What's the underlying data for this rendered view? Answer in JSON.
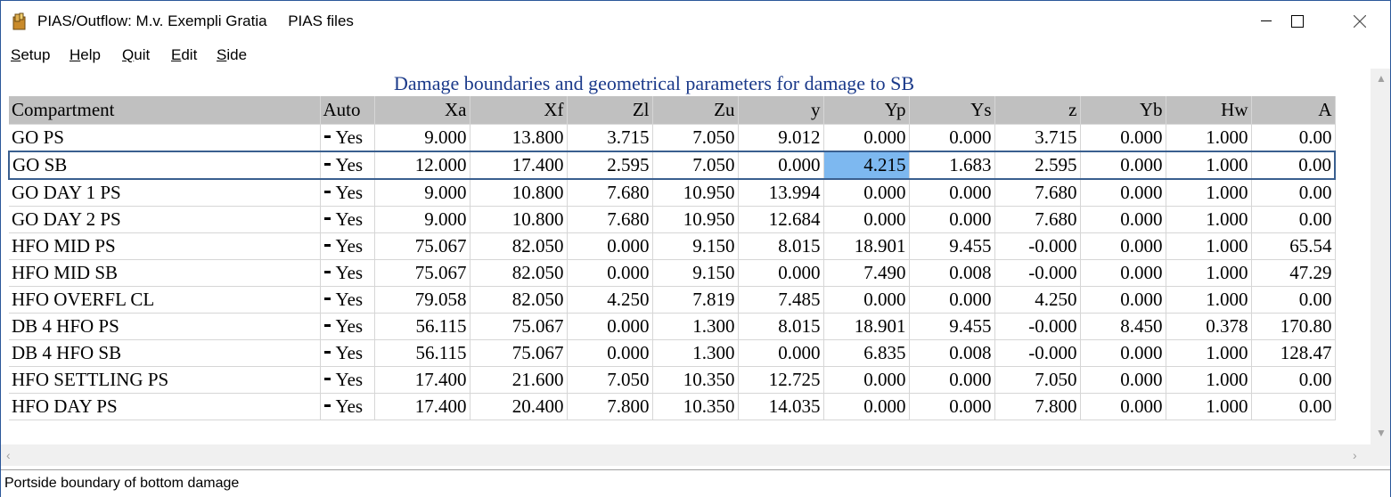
{
  "window": {
    "title": "PIAS/Outflow: M.v. Exempli Gratia     PIAS files",
    "minimize_label": "—",
    "maximize_label": "☐",
    "close_label": "✕"
  },
  "menu": [
    {
      "label": "Setup",
      "ul": "S",
      "rest": "etup"
    },
    {
      "label": "Help",
      "ul": "H",
      "rest": "elp"
    },
    {
      "label": "Quit",
      "ul": "Q",
      "rest": "uit"
    },
    {
      "label": "Edit",
      "ul": "E",
      "rest": "dit"
    },
    {
      "label": "Side",
      "ul": "S",
      "rest": "ide"
    }
  ],
  "heading": "Damage boundaries and geometrical parameters for damage to SB",
  "columns": [
    "Compartment",
    "Auto",
    "Xa",
    "Xf",
    "Zl",
    "Zu",
    "y",
    "Yp",
    "Ys",
    "z",
    "Yb",
    "Hw",
    "A"
  ],
  "rows": [
    [
      "GO PS",
      "Yes",
      "9.000",
      "13.800",
      "3.715",
      "7.050",
      "9.012",
      "0.000",
      "0.000",
      "3.715",
      "0.000",
      "1.000",
      "0.00"
    ],
    [
      "GO SB",
      "Yes",
      "12.000",
      "17.400",
      "2.595",
      "7.050",
      "0.000",
      "4.215",
      "1.683",
      "2.595",
      "0.000",
      "1.000",
      "0.00"
    ],
    [
      "GO DAY 1 PS",
      "Yes",
      "9.000",
      "10.800",
      "7.680",
      "10.950",
      "13.994",
      "0.000",
      "0.000",
      "7.680",
      "0.000",
      "1.000",
      "0.00"
    ],
    [
      "GO DAY 2 PS",
      "Yes",
      "9.000",
      "10.800",
      "7.680",
      "10.950",
      "12.684",
      "0.000",
      "0.000",
      "7.680",
      "0.000",
      "1.000",
      "0.00"
    ],
    [
      "HFO MID PS",
      "Yes",
      "75.067",
      "82.050",
      "0.000",
      "9.150",
      "8.015",
      "18.901",
      "9.455",
      "-0.000",
      "0.000",
      "1.000",
      "65.54"
    ],
    [
      "HFO MID SB",
      "Yes",
      "75.067",
      "82.050",
      "0.000",
      "9.150",
      "0.000",
      "7.490",
      "0.008",
      "-0.000",
      "0.000",
      "1.000",
      "47.29"
    ],
    [
      "HFO OVERFL CL",
      "Yes",
      "79.058",
      "82.050",
      "4.250",
      "7.819",
      "7.485",
      "0.000",
      "0.000",
      "4.250",
      "0.000",
      "1.000",
      "0.00"
    ],
    [
      "DB 4 HFO PS",
      "Yes",
      "56.115",
      "75.067",
      "0.000",
      "1.300",
      "8.015",
      "18.901",
      "9.455",
      "-0.000",
      "8.450",
      "0.378",
      "170.80"
    ],
    [
      "DB 4 HFO SB",
      "Yes",
      "56.115",
      "75.067",
      "0.000",
      "1.300",
      "0.000",
      "6.835",
      "0.008",
      "-0.000",
      "0.000",
      "1.000",
      "128.47"
    ],
    [
      "HFO SETTLING PS",
      "Yes",
      "17.400",
      "21.600",
      "7.050",
      "10.350",
      "12.725",
      "0.000",
      "0.000",
      "7.050",
      "0.000",
      "1.000",
      "0.00"
    ],
    [
      "HFO DAY PS",
      "Yes",
      "17.400",
      "20.400",
      "7.800",
      "10.350",
      "14.035",
      "0.000",
      "0.000",
      "7.800",
      "0.000",
      "1.000",
      "0.00"
    ]
  ],
  "selection": {
    "row": 1,
    "col": 7
  },
  "status": "Portside boundary of bottom damage",
  "colors": {
    "heading": "#1b3a8a",
    "header_bg": "#c0c0c0",
    "active_cell": "#7db8f0",
    "selected_row_border": "#3a5f8f"
  }
}
